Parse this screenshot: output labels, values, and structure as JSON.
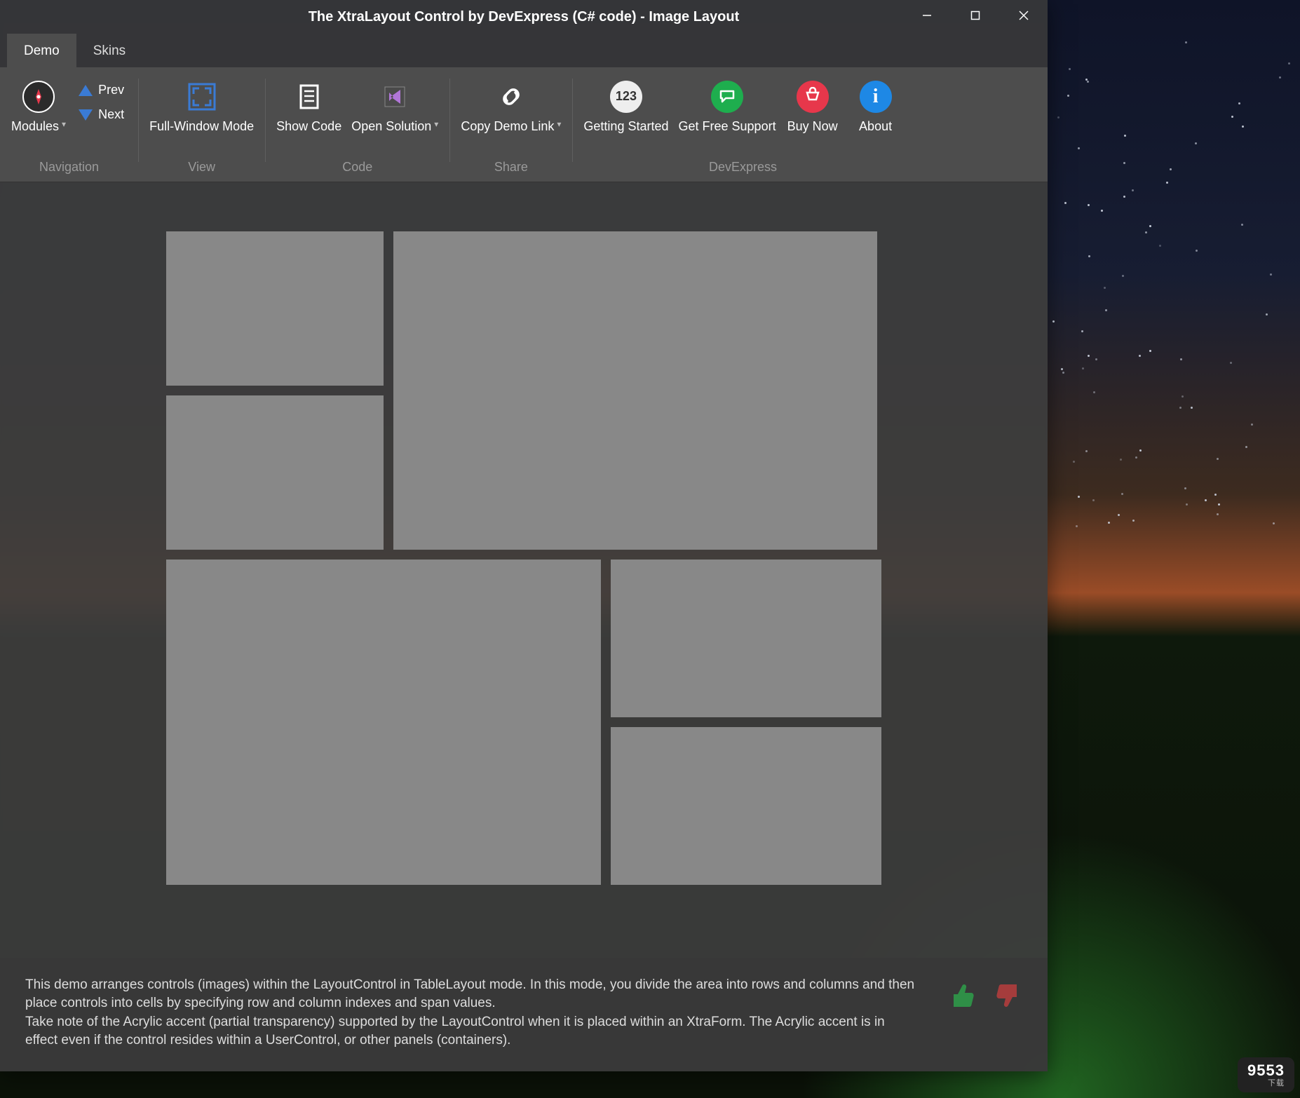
{
  "window": {
    "title": "The XtraLayout Control by DevExpress (C# code) - Image Layout"
  },
  "tabs": [
    {
      "label": "Demo",
      "active": true
    },
    {
      "label": "Skins",
      "active": false
    }
  ],
  "ribbon": {
    "groups": [
      {
        "name": "Navigation",
        "items": [
          {
            "kind": "big",
            "label": "Modules",
            "dropdown": true,
            "icon": "compass"
          },
          {
            "kind": "stack",
            "items": [
              {
                "label": "Prev",
                "icon": "tri-up"
              },
              {
                "label": "Next",
                "icon": "tri-dn"
              }
            ]
          }
        ]
      },
      {
        "name": "View",
        "items": [
          {
            "kind": "big",
            "label": "Full-Window Mode",
            "icon": "fullscreen"
          }
        ]
      },
      {
        "name": "Code",
        "items": [
          {
            "kind": "big",
            "label": "Show Code",
            "icon": "doc"
          },
          {
            "kind": "big",
            "label": "Open Solution",
            "dropdown": true,
            "icon": "vs"
          }
        ]
      },
      {
        "name": "Share",
        "items": [
          {
            "kind": "big",
            "label": "Copy Demo Link",
            "dropdown": true,
            "icon": "link"
          }
        ]
      },
      {
        "name": "DevExpress",
        "items": [
          {
            "kind": "big",
            "label": "Getting Started",
            "icon": "123"
          },
          {
            "kind": "big",
            "label": "Get Free Support",
            "icon": "chat"
          },
          {
            "kind": "big",
            "label": "Buy Now",
            "icon": "cart"
          },
          {
            "kind": "big",
            "label": "About",
            "icon": "info"
          }
        ]
      }
    ]
  },
  "images": {
    "arch": "arch",
    "night": "night",
    "empire": "esb",
    "tower": "tower",
    "theatre": "theatre",
    "eiffel": "eiffel"
  },
  "footer": {
    "line1": "This demo arranges controls (images) within the LayoutControl in TableLayout mode. In this mode, you divide the area into rows and columns and then place controls into cells by specifying row and column indexes and span values.",
    "line2": "Take note of the Acrylic accent (partial transparency) supported by the LayoutControl when it is placed within an XtraForm. The Acrylic accent is in effect even if the control resides within a UserControl, or other panels (containers)."
  },
  "logo": "9553",
  "logo_sub": "下载"
}
